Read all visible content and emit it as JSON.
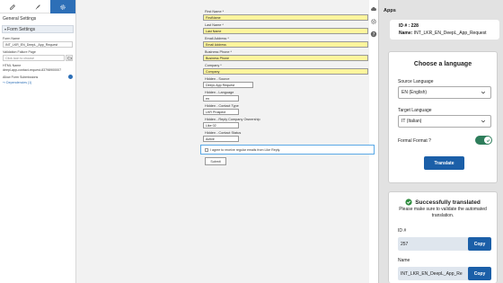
{
  "left_panel": {
    "title": "General Settings",
    "section": "Form Settings",
    "form_name_label": "Form Name",
    "form_name_value": "INT_LKR_EN_DeepL_App_Request",
    "validation_label": "Validation Failure Page",
    "validation_placeholder": "Click icon to choose",
    "html_name_label": "HTML Name",
    "html_name_value": "deepl-app-contact-request-83798900007",
    "allow_label": "Allow Form Submissions",
    "dependencies_link": "Dependencies (1)"
  },
  "form": {
    "fields": [
      {
        "label": "First Name *",
        "value": "FirstName",
        "style": "yellow"
      },
      {
        "label": "Last Name *",
        "value": "Last Name",
        "style": "yellow"
      },
      {
        "label": "Email Address *",
        "value": "Email Address",
        "style": "yellow"
      },
      {
        "label": "Business Phone *",
        "value": "Business Phone",
        "style": "yellow"
      },
      {
        "label": "Company *",
        "value": "Company",
        "style": "yellow"
      },
      {
        "label": "Hidden - Source",
        "value": "DeepL App Request",
        "style": "white"
      },
      {
        "label": "Hidden - Language",
        "value": "en",
        "style": "white"
      },
      {
        "label": "Hidden - Contact Type",
        "value": "LKR Prospect",
        "style": "white"
      },
      {
        "label": "Hidden - Reply Company Ownership",
        "value": "Like 02",
        "style": "white"
      },
      {
        "label": "Hidden - Contact Status",
        "value": "Active",
        "style": "white"
      }
    ],
    "consent": "I agree to receive regular emails from Like Reply.",
    "submit": "Submit"
  },
  "apps": {
    "title": "Apps",
    "id_line": "ID # : 228",
    "name_label": "Name:",
    "name_value": "INT_LKR_EN_DeepL_App_Request",
    "language_card": {
      "title": "Choose a language",
      "source_label": "Source Language",
      "source_value": "EN (English)",
      "target_label": "Target Language",
      "target_value": "IT (Italian)",
      "formal_label": "Formal Format ?",
      "formal_on": true,
      "translate_button": "Translate"
    },
    "result_card": {
      "title": "Successfully translated",
      "message": "Please make sure to validate the automated translation.",
      "id_label": "ID #",
      "id_value": "257",
      "name_label": "Name",
      "name_value": "INT_LKR_EN_DeepL_App_Re",
      "copy_label": "Copy"
    }
  },
  "colors": {
    "accent": "#1b5fa8",
    "highlight_field": "#fff59d",
    "toggle_on": "#2e7d5b",
    "success": "#2e8b3e"
  }
}
